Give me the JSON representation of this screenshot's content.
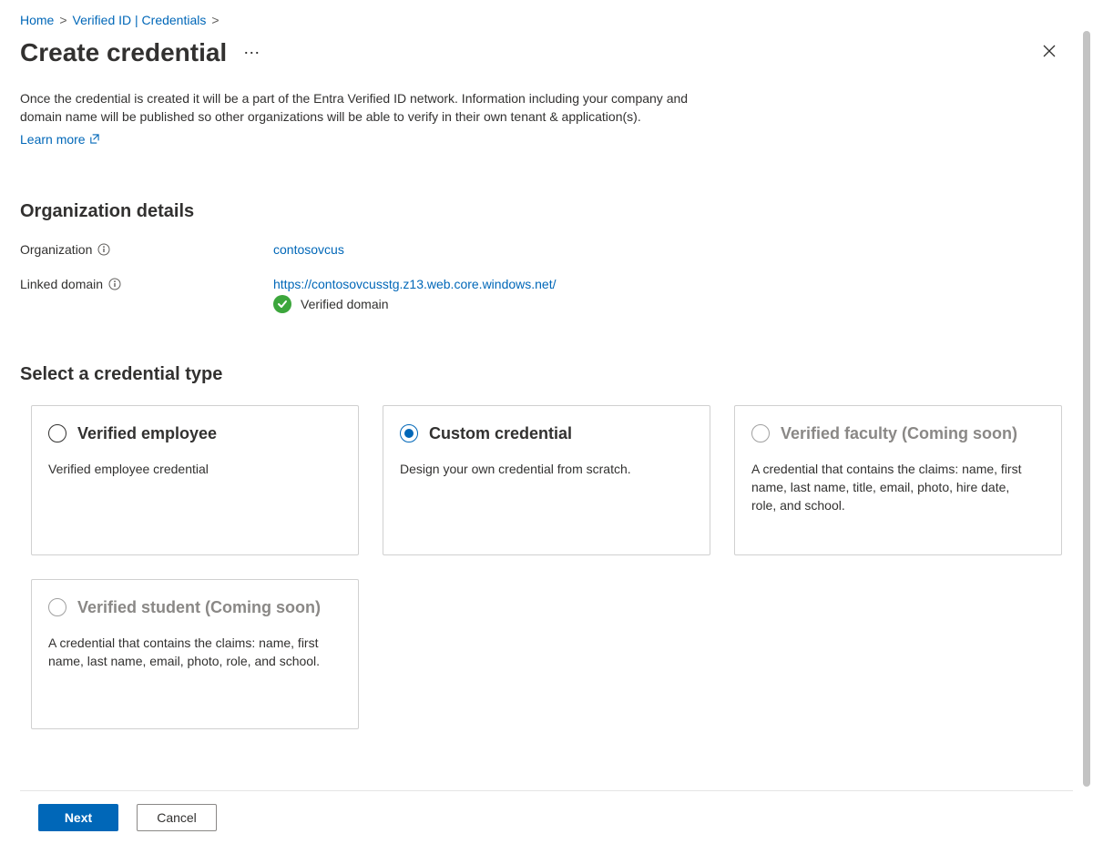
{
  "breadcrumb": {
    "home": "Home",
    "verified_id": "Verified ID | Credentials"
  },
  "title": "Create credential",
  "description": "Once the credential is created it will be a part of the Entra Verified ID network. Information including your company and domain name will be published so other organizations will be able to verify in their own tenant & application(s).",
  "learn_more": "Learn more",
  "sections": {
    "org_details": "Organization details",
    "select_type": "Select a credential type"
  },
  "org": {
    "org_label": "Organization",
    "org_value": "contosovcus",
    "domain_label": "Linked domain",
    "domain_value": "https://contosovcusstg.z13.web.core.windows.net/",
    "verified_label": "Verified domain"
  },
  "cards": [
    {
      "id": "verified-employee",
      "title": "Verified employee",
      "body": "Verified employee credential",
      "selected": false,
      "disabled": false
    },
    {
      "id": "custom-credential",
      "title": "Custom credential",
      "body": "Design your own credential from scratch.",
      "selected": true,
      "disabled": false
    },
    {
      "id": "verified-faculty",
      "title": "Verified faculty (Coming soon)",
      "body": "A credential that contains the claims: name, first name, last name, title, email, photo, hire date, role, and school.",
      "selected": false,
      "disabled": true
    },
    {
      "id": "verified-student",
      "title": "Verified student (Coming soon)",
      "body": "A credential that contains the claims: name, first name, last name, email, photo, role, and school.",
      "selected": false,
      "disabled": true
    }
  ],
  "footer": {
    "next": "Next",
    "cancel": "Cancel"
  }
}
